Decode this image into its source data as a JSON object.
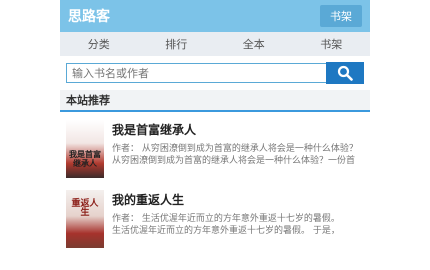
{
  "header": {
    "title": "思路客",
    "shelf_button": "书架"
  },
  "nav": {
    "items": [
      "分类",
      "排行",
      "全本",
      "书架"
    ]
  },
  "search": {
    "placeholder": "输入书名或作者",
    "icon": "search-icon"
  },
  "section": {
    "title": "本站推荐"
  },
  "books": [
    {
      "title": "我是首富继承人",
      "author_line": "作者：  从穷困潦倒到成为首富的继承人将会是一种什么体验？",
      "desc_line": "从穷困潦倒到成为首富的继承人将会是一种什么体验？一份首",
      "cover_text": "我是首富继承人"
    },
    {
      "title": "我的重返人生",
      "author_line": "作者：  生活优渥年近而立的方年意外重返十七岁的暑假。",
      "desc_line": "生活优渥年近而立的方年意外重返十七岁的暑假。        于是，",
      "cover_text": "重返人生"
    }
  ],
  "colors": {
    "topbar": "#7cc3e8",
    "accent": "#1e78c2"
  }
}
